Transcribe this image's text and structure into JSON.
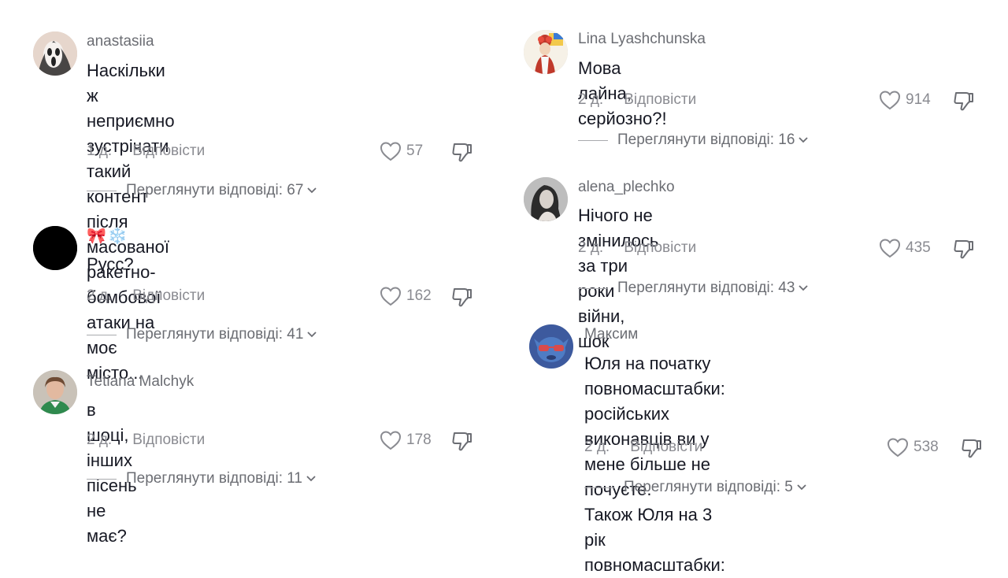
{
  "left": [
    {
      "user": "anastasiia",
      "lines": [
        "Наскільки ж неприємно зустрічати такий",
        "контент після масованої ракетно-бомбової",
        "атаки на моє місто..."
      ],
      "age": "1 д.",
      "reply": "Відповісти",
      "likes": "57",
      "view": "Переглянути відповіді: 67"
    },
    {
      "user": "🎀❄️",
      "lines": [
        "Русс?"
      ],
      "age": "2 д.",
      "reply": "Відповісти",
      "likes": "162",
      "view": "Переглянути відповіді: 41"
    },
    {
      "user": "Tetiana Malchyk",
      "lines": [
        "в шоці, інших пісень не має?"
      ],
      "age": "2 д.",
      "reply": "Відповісти",
      "likes": "178",
      "view": "Переглянути відповіді: 11"
    }
  ],
  "right": [
    {
      "user": "Lina Lyashchunska",
      "lines": [
        "Мова лайна, серйозно?!"
      ],
      "age": "2 д.",
      "reply": "Відповісти",
      "likes": "914",
      "view": "Переглянути відповіді: 16"
    },
    {
      "user": "alena_plechko",
      "lines": [
        "Нічого не змінилось за три роки війни, шок"
      ],
      "age": "2 д.",
      "reply": "Відповісти",
      "likes": "435",
      "view": "Переглянути відповіді: 43"
    },
    {
      "user": "Максим",
      "lines": [
        "Юля на початку повномасштабки: російських",
        "виконавців ви у мене більше не почуєте.",
        "Також Юля на 3 рік повномасштабки:"
      ],
      "age": "2 д.",
      "reply": "Відповісти",
      "likes": "538",
      "view": "Переглянути відповіді: 5"
    }
  ]
}
